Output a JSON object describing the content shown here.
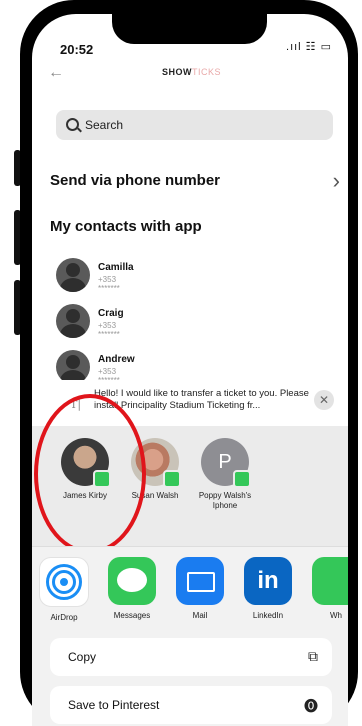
{
  "status": {
    "time": "20:52",
    "icons": ".ııl ☷ ▭"
  },
  "header": {
    "brand_main": "SHOW",
    "brand_accent": "TICKS"
  },
  "search": {
    "label": "Search"
  },
  "phone_section": {
    "label": "Send via phone number"
  },
  "contacts_section": {
    "title": "My contacts with app",
    "contacts": [
      {
        "name": "Camilla",
        "phone": "+353 *******"
      },
      {
        "name": "Craig",
        "phone": "+353 *******"
      },
      {
        "name": "Andrew",
        "phone": "+353 *******"
      }
    ]
  },
  "share_sheet": {
    "message": "Hello! I would like to transfer a ticket to you. Please install Principality Stadium Ticketing fr...",
    "people": [
      {
        "name": "James Kirby"
      },
      {
        "name": "Susan Walsh"
      },
      {
        "name": "Poppy Walsh's Iphone",
        "initial": "P"
      }
    ],
    "apps": [
      {
        "label": "AirDrop",
        "icon": "airdrop-icon"
      },
      {
        "label": "Messages",
        "icon": "messages-icon"
      },
      {
        "label": "Mail",
        "icon": "mail-icon"
      },
      {
        "label": "LinkedIn",
        "icon": "linkedin-icon"
      },
      {
        "label": "Wh",
        "icon": "whatsapp-icon"
      }
    ],
    "actions": [
      {
        "label": "Copy",
        "icon": "copy-icon"
      },
      {
        "label": "Save to Pinterest",
        "icon": "pinterest-icon"
      }
    ]
  },
  "colors": {
    "highlight_ring": "#e0151b",
    "imessage_badge": "#34c759"
  }
}
